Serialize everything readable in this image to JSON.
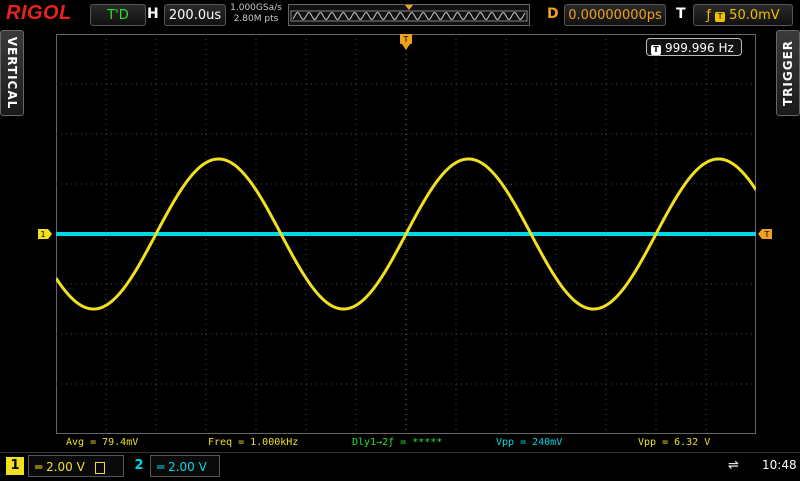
{
  "brand": "RIGOL",
  "top": {
    "run_status": "T'D",
    "h_label": "H",
    "timebase": "200.0us",
    "sample_rate": "1.000GSa/s",
    "memory_depth": "2.80M pts",
    "d_label": "D",
    "delay": "0.00000000ps",
    "t_label": "T",
    "trigger_level": "50.0mV",
    "trigger_source_marker": "T"
  },
  "side": {
    "left_tab": "VERTICAL",
    "right_tab": "TRIGGER"
  },
  "freq_counter": {
    "badge": "T",
    "value": "999.996 Hz"
  },
  "markers": {
    "ch1": "1",
    "trigger_level": "T",
    "trigger_pos": "T"
  },
  "measurements": {
    "avg": "Avg = 79.4mV",
    "freq": "Freq = 1.000kHz",
    "dly": "Dly1→2ƒ = *****",
    "vpp2": "Vpp = 240mV",
    "vpp1": "Vpp = 6.32 V"
  },
  "channels": [
    {
      "num": "1",
      "scale": "2.00 V",
      "coupling": "═"
    },
    {
      "num": "2",
      "scale": "2.00 V",
      "coupling": "═"
    }
  ],
  "status": {
    "clock": "10:48"
  },
  "colors": {
    "ch1": "#f0e020",
    "ch2": "#00d8e8",
    "trigger": "#f0a11f",
    "grid": "#555555"
  },
  "waveforms": {
    "ch1": {
      "type": "sine",
      "frequency_hz": 1000,
      "vpp_v": 6.32,
      "volts_per_div": 2.0
    },
    "ch2": {
      "type": "dc",
      "volts_per_div": 2.0,
      "level_v": 0
    },
    "time_per_div_s": 0.0002,
    "h_divisions": 14,
    "v_divisions": 8
  }
}
